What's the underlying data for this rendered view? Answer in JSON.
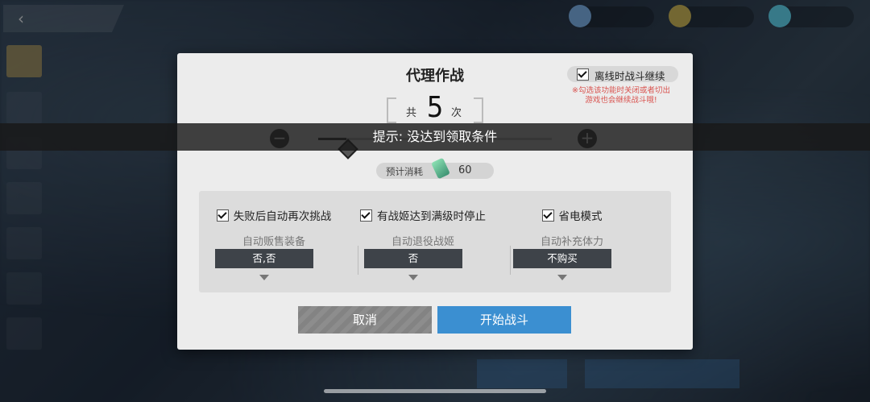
{
  "dialog": {
    "title": "代理作战",
    "offline": {
      "label": "离线时战斗继续",
      "checked": true,
      "note": "※勾选该功能时关闭或者切出游戏也会继续战斗哦!"
    },
    "count": {
      "prefix": "共",
      "value": "5",
      "suffix": "次"
    },
    "slider": {
      "minus": "−",
      "plus": "+",
      "value_fraction": 0.12
    },
    "toast": "提示: 没达到领取条件",
    "cost": {
      "label": "预计消耗",
      "value": "60",
      "icon": "energy-icon"
    },
    "options": [
      {
        "check_label": "失败后自动再次挑战",
        "checked": true,
        "select_label": "自动贩售装备",
        "select_value": "否,否"
      },
      {
        "check_label": "有战姬达到满级时停止",
        "checked": true,
        "select_label": "自动退役战姬",
        "select_value": "否"
      },
      {
        "check_label": "省电模式",
        "checked": true,
        "select_label": "自动补充体力",
        "select_value": "不购买"
      }
    ],
    "buttons": {
      "cancel": "取消",
      "start": "开始战斗"
    }
  },
  "colors": {
    "start_button": "#3b8fd1",
    "note_red": "#d9534f",
    "toast_bg": "#191919"
  }
}
